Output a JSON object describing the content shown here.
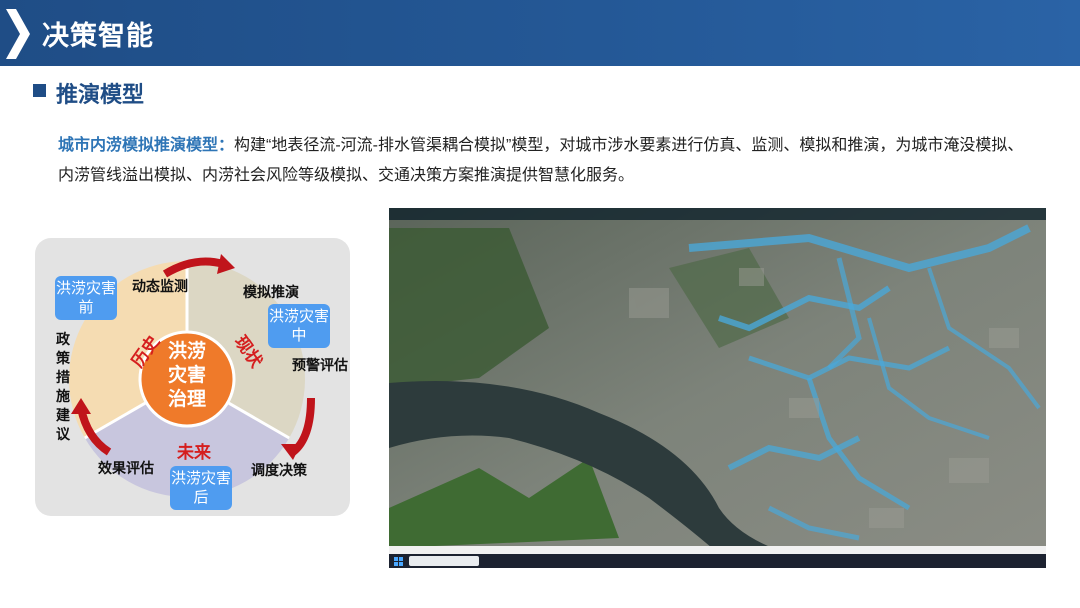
{
  "header": {
    "title": "决策智能"
  },
  "section": {
    "title": "推演模型"
  },
  "description": {
    "highlight": "城市内涝模拟推演模型：",
    "text": "构建“地表径流-河流-排水管渠耦合模拟”模型，对城市涉水要素进行仿真、监测、模拟和推演，为城市淹没模拟、内涝管线溢出模拟、内涝社会风险等级模拟、交通决策方案推演提供智慧化服务。"
  },
  "diagram": {
    "center": "洪涝灾害治理",
    "eras": {
      "past": "历史",
      "present": "现状",
      "future": "未来"
    },
    "badges": {
      "before": "洪涝灾害前",
      "during": "洪涝灾害中",
      "after": "洪涝灾害后"
    },
    "steps": {
      "monitor": "动态监测",
      "simulate": "模拟推演",
      "warn": "预警评估",
      "dispatch": "调度决策",
      "evaluate": "效果评估",
      "policy": "政策措施建议"
    },
    "colors": {
      "past": "#f5dcb2",
      "present": "#dcd7c4",
      "future": "#c8c6de",
      "center": "#ef7a2a",
      "arrow": "#c0141b",
      "badge": "#4f9cf0"
    }
  },
  "screenshot": {
    "description_icons": [
      "search-icon",
      "windows-start-icon"
    ]
  }
}
